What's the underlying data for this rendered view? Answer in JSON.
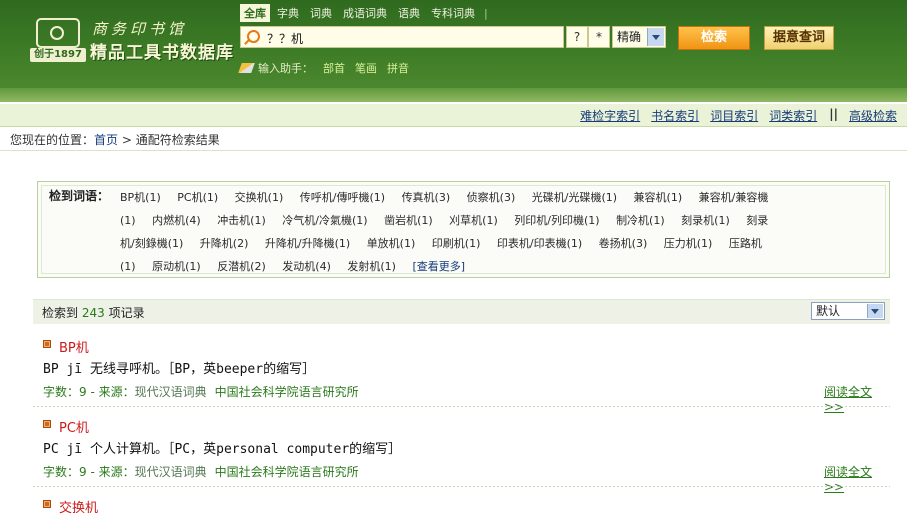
{
  "header": {
    "brand_calligraphy": "商务印书馆",
    "brand_product": "精品工具书数据库",
    "founded": "创于1897",
    "search_tabs": [
      "全库",
      "字典",
      "词典",
      "成语词典",
      "语典",
      "专科词典"
    ],
    "tabs_separator": "|",
    "search": {
      "value": "？？机",
      "placeholder": ""
    },
    "wildcard_question": "?",
    "wildcard_star": "*",
    "match_mode": "精确",
    "search_button": "检索",
    "random_query_button": "据意查词",
    "input_helper_label": "输入助手：",
    "input_helper_links": [
      "部首",
      "笔画",
      "拼音"
    ]
  },
  "index_bar": {
    "links": [
      "难检字索引",
      "书名索引",
      "词目索引",
      "词类索引"
    ],
    "separator": "||",
    "advanced": "高级检索"
  },
  "breadcrumb": {
    "prefix": "您现在的位置：",
    "home": "首页",
    "arrow": ">",
    "current": "通配符检索结果"
  },
  "hits": {
    "label": "检到词语：",
    "lines": [
      [
        "BP机(1)",
        "PC机(1)",
        "交换机(1)",
        "传呼机/傳呼機(1)",
        "传真机(3)",
        "侦察机(3)",
        "光碟机/光碟機(1)",
        "兼容机(1)",
        "兼容机/兼容機"
      ],
      [
        "(1)",
        "内燃机(4)",
        "冲击机(1)",
        "冷气机/冷氣機(1)",
        "凿岩机(1)",
        "刈草机(1)",
        "列印机/列印機(1)",
        "制冷机(1)",
        "刻录机(1)",
        "刻录"
      ],
      [
        "机/刻錄機(1)",
        "升降机(2)",
        "升降机/升降機(1)",
        "单放机(1)",
        "印刷机(1)",
        "印表机/印表機(1)",
        "卷扬机(3)",
        "压力机(1)",
        "压路机"
      ],
      [
        "(1)",
        "原动机(1)",
        "反潜机(2)",
        "发动机(4)",
        "发射机(1)"
      ]
    ],
    "more": "[查看更多]"
  },
  "results_header": {
    "prefix": "检索到",
    "count": "243",
    "suffix": "项记录",
    "sort": "默认"
  },
  "results": [
    {
      "title": "BP机",
      "body": "BP jī 无线寻呼机。［BP，英beeper的缩写］",
      "meta_chars": "字数：9 - 来源：",
      "source": "现代汉语词典",
      "org": "中国社会科学院语言研究所",
      "read_more": "阅读全文>>"
    },
    {
      "title": "PC机",
      "body": "PC jī 个人计算机。［PC，英personal computer的缩写］",
      "meta_chars": "字数：9 - 来源：",
      "source": "现代汉语词典",
      "org": "中国社会科学院语言研究所",
      "read_more": "阅读全文>>"
    },
    {
      "title": "交换机"
    }
  ]
}
